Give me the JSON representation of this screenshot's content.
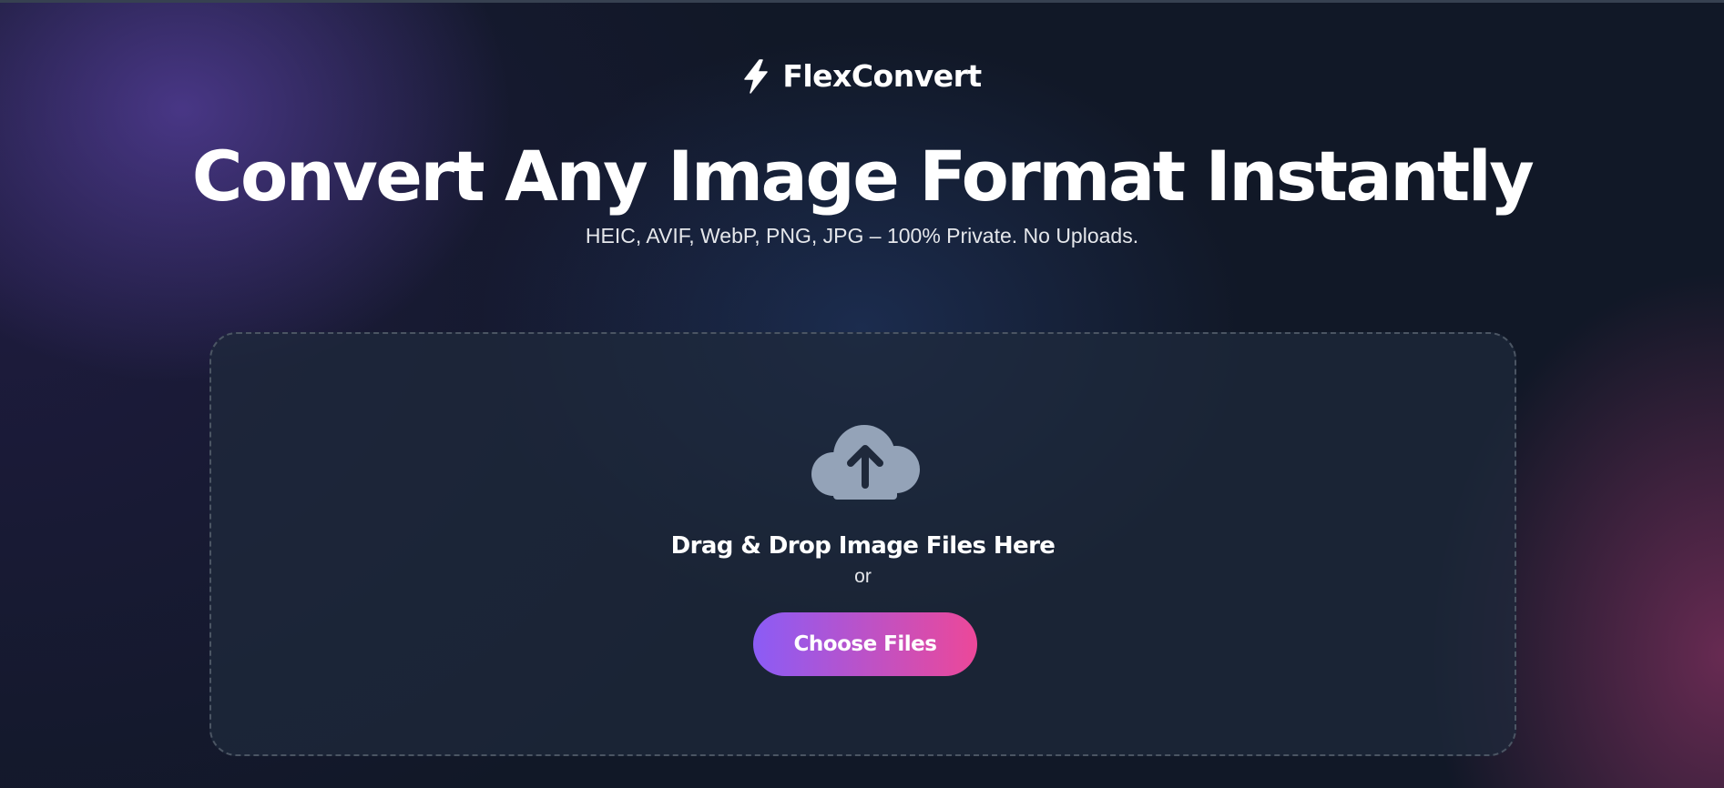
{
  "brand": {
    "name": "FlexConvert",
    "icon": "lightning-bolt-icon"
  },
  "hero": {
    "title": "Convert Any Image Format Instantly",
    "subtitle": "HEIC, AVIF, WebP, PNG, JPG – 100% Private. No Uploads."
  },
  "dropzone": {
    "icon": "cloud-upload-icon",
    "title": "Drag & Drop Image Files Here",
    "or_text": "or",
    "button_label": "Choose Files"
  },
  "colors": {
    "background": "#111827",
    "dropzone_bg": "#1f293b",
    "dropzone_border": "#4b5563",
    "icon_gray": "#94a3b8",
    "button_gradient_start": "#8b5cf6",
    "button_gradient_end": "#ec4899"
  }
}
